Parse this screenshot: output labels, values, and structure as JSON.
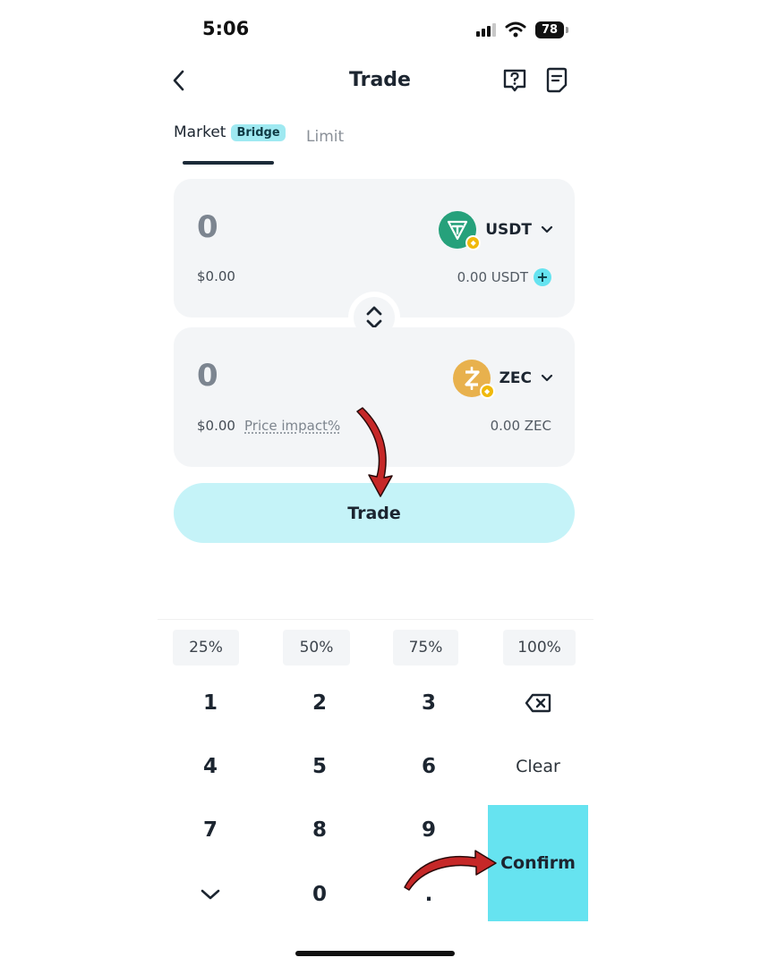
{
  "status_bar": {
    "time": "5:06",
    "battery": "78"
  },
  "header": {
    "title": "Trade"
  },
  "tabs": {
    "market": "Market",
    "market_badge": "Bridge",
    "limit": "Limit"
  },
  "from_card": {
    "amount": "0",
    "fiat": "$0.00",
    "token": "USDT",
    "balance": "0.00 USDT"
  },
  "to_card": {
    "amount": "0",
    "fiat": "$0.00",
    "price_impact": "Price impact%",
    "token": "ZEC",
    "balance": "0.00 ZEC"
  },
  "trade_button": "Trade",
  "percent_shortcuts": [
    "25%",
    "50%",
    "75%",
    "100%"
  ],
  "keypad": {
    "digits": [
      "1",
      "2",
      "3",
      "4",
      "5",
      "6",
      "7",
      "8",
      "9",
      "0"
    ],
    "decimal": ".",
    "clear": "Clear",
    "confirm": "Confirm"
  },
  "colors": {
    "accent": "#66e3f0",
    "accent_light": "#c5f3f8",
    "badge": "#9fe9f1",
    "annotation_arrow": "#c62828",
    "usdt": "#26a17b",
    "zec": "#e8b14d"
  },
  "icons": [
    "signal-icon",
    "wifi-icon",
    "battery-icon",
    "back-arrow-icon",
    "help-icon",
    "order-history-icon",
    "usdt-token-icon",
    "zec-token-icon",
    "chevron-down-icon",
    "plus-icon",
    "swap-direction-icon",
    "backspace-icon",
    "collapse-keyboard-icon"
  ]
}
